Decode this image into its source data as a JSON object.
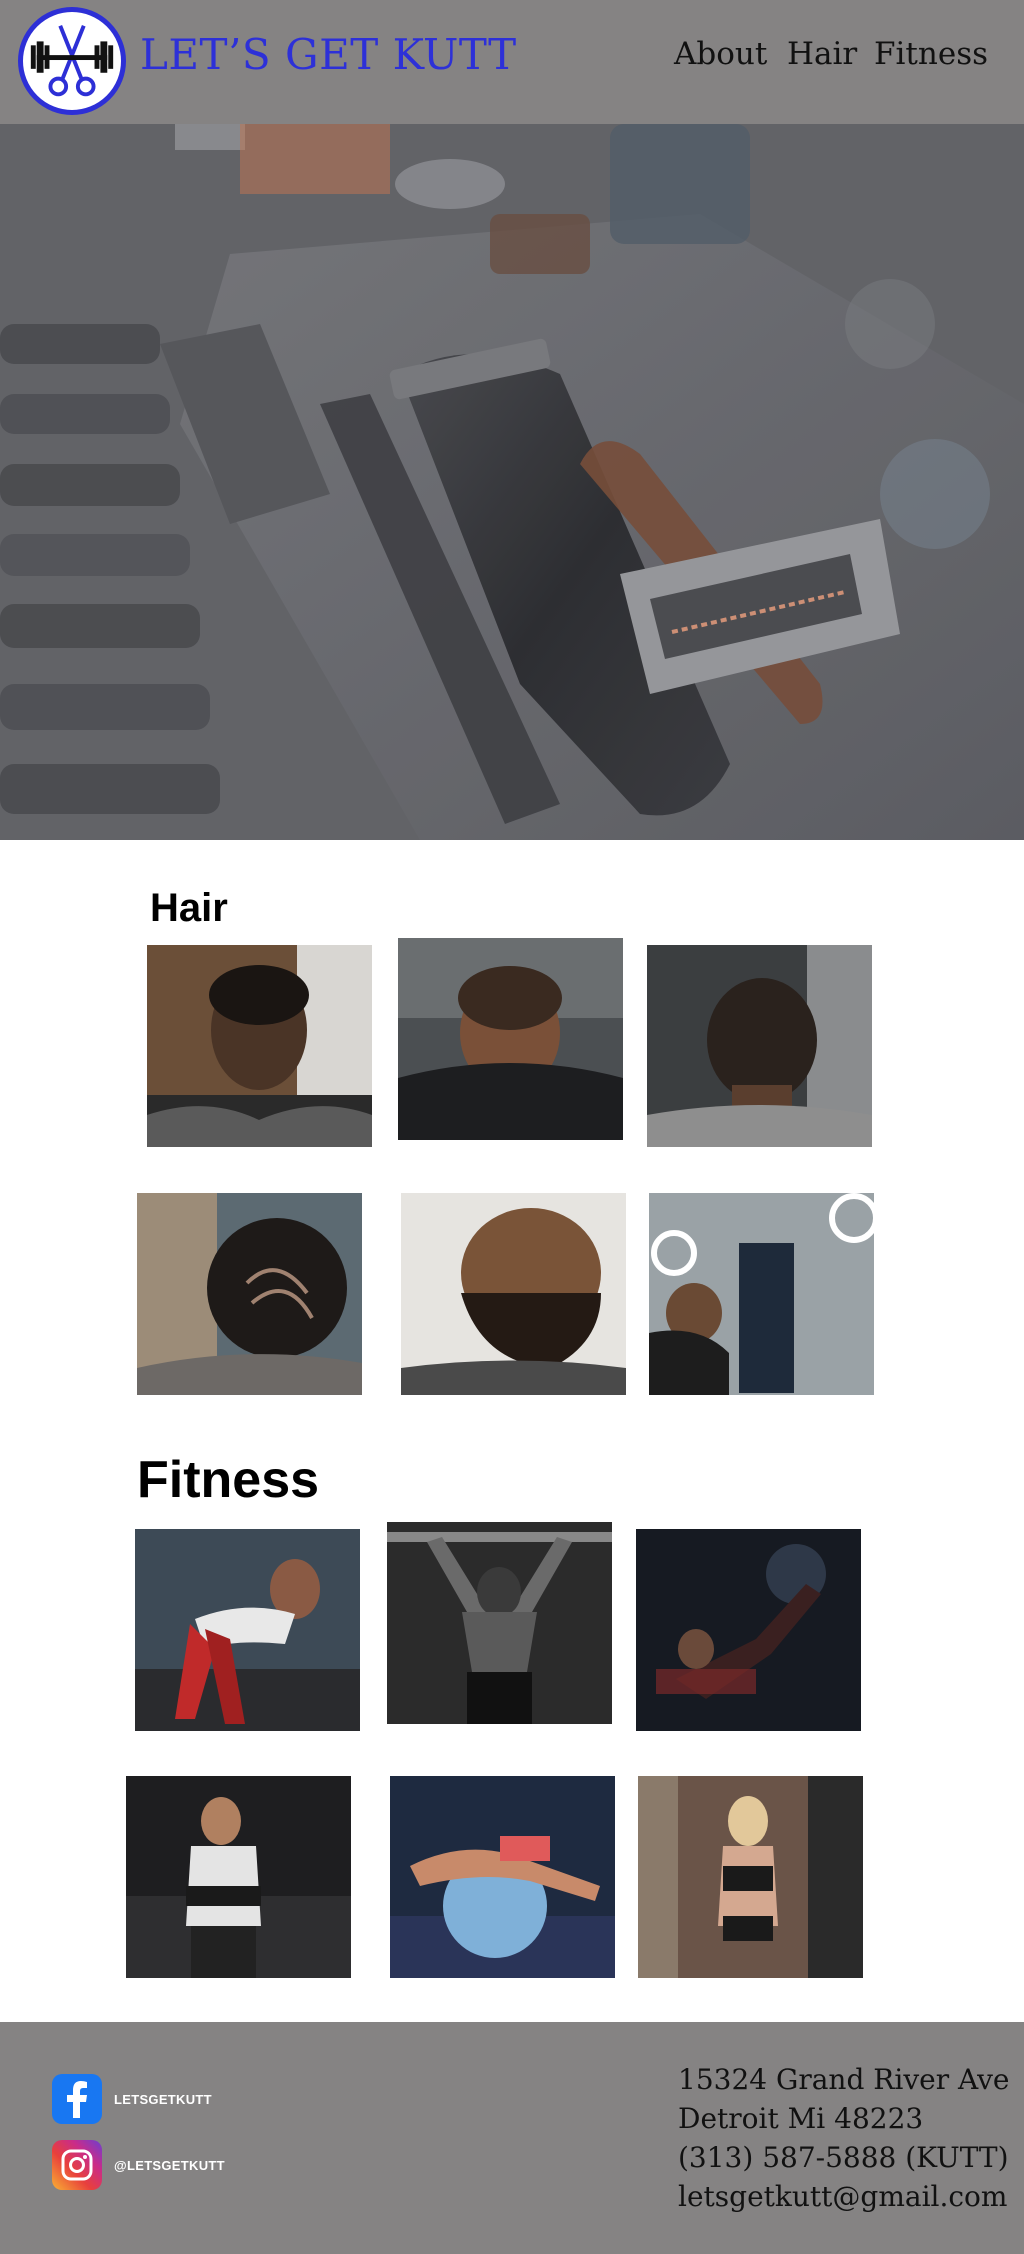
{
  "header": {
    "brand": "LET’S GET KUTT",
    "nav": [
      "About",
      "Hair",
      "Fitness"
    ]
  },
  "icons": {
    "logo": "barbell-scissors-logo-icon",
    "facebook": "facebook-icon",
    "instagram": "instagram-icon"
  },
  "hair": {
    "title": "Hair",
    "photos": [
      "man-with-mustache-haircut",
      "boy-fresh-fade",
      "back-of-head-taper",
      "hair-design-pattern",
      "bald-head-with-beard",
      "barber-cutting-client"
    ]
  },
  "fitness": {
    "title": "Fitness",
    "photos": [
      "woman-dumbbell-row",
      "man-pull-up-back",
      "woman-leg-press",
      "man-weight-belt",
      "woman-exercise-ball-stretch",
      "woman-battle-ropes"
    ]
  },
  "footer": {
    "facebook_label": "LETSGETKUTT",
    "instagram_label": "@LETSGETKUTT",
    "address_line1": "15324 Grand River Ave",
    "address_line2": "Detroit Mi 48223",
    "phone": "(313) 587-5888 (KUTT)",
    "email": "letsgetkutt@gmail.com"
  },
  "colors": {
    "header_bg": "#858383",
    "brand_blue": "#2d30d8",
    "footer_bg": "#858383"
  }
}
